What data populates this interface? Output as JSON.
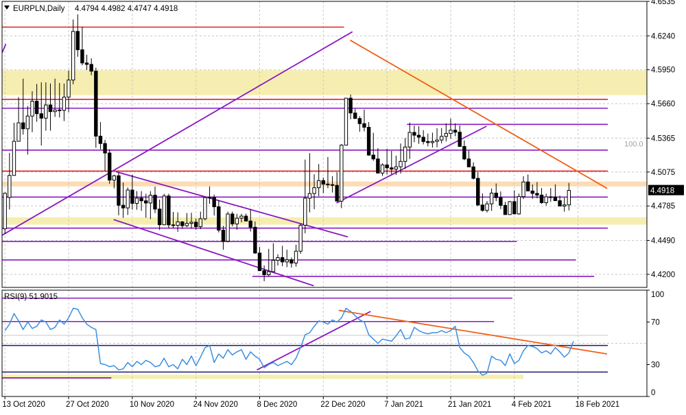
{
  "colors": {
    "grid": "#c8c8c8",
    "frame": "#000000",
    "bull": "#ffffff",
    "bear": "#000000",
    "zone": "#f5eeb0",
    "zone_orange": "#fcdcb4",
    "red_line": "#e02020",
    "purple_line": "#8a18c0",
    "orange_line": "#f06018",
    "rsi_line": "#3a8ee0",
    "price_marker_bg": "#000000",
    "price_marker_text": "#ffffff",
    "fib_label": "#a0a0a0"
  },
  "chart_data": [
    {
      "type": "candlestick",
      "title": "EURPLN,Daily",
      "ohlc_label": "4.4794 4.4982 4.4747 4.4918",
      "current_price": 4.4918,
      "current_price_label": "4.4918",
      "ylim": [
        4.4088,
        4.6535
      ],
      "y_ticks": [
        4.6535,
        4.624,
        4.595,
        4.566,
        4.5365,
        4.5075,
        4.4785,
        4.449,
        4.42
      ],
      "y_tick_labels": [
        "4.6535",
        "4.6240",
        "4.5950",
        "4.5660",
        "4.5365",
        "4.5075",
        "4.4785",
        "4.4490",
        "4.4200"
      ],
      "fib_label": "100.0",
      "fib_level": 4.5317,
      "x_labels": [
        "13 Oct 2020",
        "27 Oct 2020",
        "10 Nov 2020",
        "24 Nov 2020",
        "8 Dec 2020",
        "22 Dec 2020",
        "7 Jan 2021",
        "21 Jan 2021",
        "4 Feb 2021",
        "18 Feb 2021"
      ],
      "x_label_bars": [
        0,
        14,
        28,
        42,
        56,
        70,
        84,
        98,
        112,
        126
      ],
      "bar_count": 133,
      "candles": [
        [
          4.4589,
          4.49,
          4.4546,
          4.4894
        ],
        [
          4.4858,
          4.5239,
          4.4755,
          4.5046
        ],
        [
          4.5046,
          4.5496,
          4.5046,
          4.5338
        ],
        [
          4.5338,
          4.5716,
          4.534,
          4.5496
        ],
        [
          4.5496,
          4.5874,
          4.5396,
          4.5445
        ],
        [
          4.5445,
          4.564,
          4.5224,
          4.5554
        ],
        [
          4.5554,
          4.5766,
          4.5416,
          4.5681
        ],
        [
          4.5681,
          4.5829,
          4.5505,
          4.5574
        ],
        [
          4.5574,
          4.5842,
          4.5302,
          4.5536
        ],
        [
          4.5536,
          4.5842,
          4.5429,
          4.5649
        ],
        [
          4.5649,
          4.5832,
          4.5429,
          4.5592
        ],
        [
          4.5592,
          4.5874,
          4.5547,
          4.5606
        ],
        [
          4.5606,
          4.5837,
          4.5542,
          4.5603
        ],
        [
          4.5603,
          4.5832,
          4.5511,
          4.5716
        ],
        [
          4.5716,
          4.5943,
          4.5587,
          4.5862
        ],
        [
          4.5862,
          4.638,
          4.5826,
          4.6278
        ],
        [
          4.6278,
          4.6424,
          4.6061,
          4.6121
        ],
        [
          4.6121,
          4.6316,
          4.5988,
          4.6008
        ],
        [
          4.6008,
          4.6079,
          4.5948,
          4.5996
        ],
        [
          4.5996,
          4.6048,
          4.5903,
          4.5938
        ],
        [
          4.5938,
          4.5967,
          4.5283,
          4.5382
        ],
        [
          4.5382,
          4.5502,
          4.527,
          4.5319
        ],
        [
          4.5319,
          4.535,
          4.5083,
          4.5238
        ],
        [
          4.5238,
          4.527,
          4.4975,
          4.5006
        ],
        [
          4.5006,
          4.5052,
          4.4936,
          4.5043
        ],
        [
          4.5043,
          4.507,
          4.4705,
          4.4791
        ],
        [
          4.4791,
          4.4985,
          4.4684,
          4.4768
        ],
        [
          4.4768,
          4.4943,
          4.4708,
          4.4921
        ],
        [
          4.4921,
          4.5052,
          4.4753,
          4.4807
        ],
        [
          4.4807,
          4.4912,
          4.4753,
          4.4852
        ],
        [
          4.4852,
          4.4912,
          4.4743,
          4.4829
        ],
        [
          4.4829,
          4.4889,
          4.4684,
          4.481
        ],
        [
          4.481,
          4.4912,
          4.4673,
          4.4877
        ],
        [
          4.4877,
          4.495,
          4.4724,
          4.4758
        ],
        [
          4.4758,
          4.4839,
          4.4579,
          4.4624
        ],
        [
          4.4624,
          4.4889,
          4.462,
          4.487
        ],
        [
          4.487,
          4.4889,
          4.4594,
          4.4623
        ],
        [
          4.4623,
          4.4734,
          4.4594,
          4.4619
        ],
        [
          4.4619,
          4.473,
          4.4564,
          4.4649
        ],
        [
          4.4649,
          4.4655,
          4.459,
          4.4616
        ],
        [
          4.4616,
          4.4724,
          4.4604,
          4.4636
        ],
        [
          4.4636,
          4.4727,
          4.4591,
          4.4646
        ],
        [
          4.4646,
          4.4677,
          4.4581,
          4.4608
        ],
        [
          4.4608,
          4.4736,
          4.4586,
          4.4675
        ],
        [
          4.4675,
          4.4867,
          4.4662,
          4.4857
        ],
        [
          4.4857,
          4.4952,
          4.4803,
          4.4859
        ],
        [
          4.4859,
          4.4882,
          4.4703,
          4.4778
        ],
        [
          4.4778,
          4.4834,
          4.4558,
          4.4578
        ],
        [
          4.4578,
          4.4615,
          4.4411,
          4.4483
        ],
        [
          4.4483,
          4.4736,
          4.4474,
          4.4716
        ],
        [
          4.4716,
          4.4736,
          4.461,
          4.4631
        ],
        [
          4.4631,
          4.4717,
          4.4581,
          4.468
        ],
        [
          4.468,
          4.4718,
          4.4645,
          4.4698
        ],
        [
          4.4698,
          4.4719,
          4.4662,
          4.4656
        ],
        [
          4.4656,
          4.4757,
          4.4566,
          4.4603
        ],
        [
          4.4603,
          4.4652,
          4.4376,
          4.4382
        ],
        [
          4.4382,
          4.4434,
          4.428,
          4.4231
        ],
        [
          4.4231,
          4.4276,
          4.4141,
          4.4197
        ],
        [
          4.4197,
          4.4418,
          4.4184,
          4.4223
        ],
        [
          4.4223,
          4.4466,
          4.4218,
          4.432
        ],
        [
          4.432,
          4.4372,
          4.4275,
          4.4343
        ],
        [
          4.4343,
          4.4444,
          4.4269,
          4.4306
        ],
        [
          4.4306,
          4.4411,
          4.4261,
          4.4324
        ],
        [
          4.4324,
          4.4344,
          4.4258,
          4.4296
        ],
        [
          4.4296,
          4.4453,
          4.4266,
          4.4398
        ],
        [
          4.4398,
          4.4632,
          4.4376,
          4.462
        ],
        [
          4.462,
          4.5182,
          4.4551,
          4.4851
        ],
        [
          4.4851,
          4.5236,
          4.473,
          4.4891
        ],
        [
          4.4891,
          4.5056,
          4.4757,
          4.4941
        ],
        [
          4.4941,
          4.5143,
          4.4868,
          4.5002
        ],
        [
          4.5002,
          4.5028,
          4.4893,
          4.4972
        ],
        [
          4.4972,
          4.5203,
          4.4937,
          4.4967
        ],
        [
          4.4967,
          4.504,
          4.49,
          4.4961
        ],
        [
          4.4961,
          4.5073,
          4.4862,
          4.4826
        ],
        [
          4.4826,
          4.5314,
          4.4766,
          4.5305
        ],
        [
          4.5305,
          4.5708,
          4.5305,
          4.5707
        ],
        [
          4.5707,
          4.5738,
          4.5526,
          4.558
        ],
        [
          4.558,
          4.5615,
          4.5531,
          4.5533
        ],
        [
          4.5533,
          4.5553,
          4.542,
          4.5489
        ],
        [
          4.5489,
          4.561,
          4.5423,
          4.5458
        ],
        [
          4.5458,
          4.5503,
          4.5214,
          4.522
        ],
        [
          4.522,
          4.5411,
          4.5171,
          4.5187
        ],
        [
          4.5187,
          4.5279,
          4.508,
          4.5066
        ],
        [
          4.5066,
          4.5149,
          4.5041,
          4.5136
        ],
        [
          4.5136,
          4.5275,
          4.5055,
          4.5111
        ],
        [
          4.5111,
          4.5256,
          4.5055,
          4.51
        ],
        [
          4.51,
          4.5215,
          4.5051,
          4.512
        ],
        [
          4.512,
          4.5319,
          4.5062,
          4.5166
        ],
        [
          4.5166,
          4.5366,
          4.5101,
          4.5289
        ],
        [
          4.5289,
          4.5498,
          4.5186,
          4.5414
        ],
        [
          4.5414,
          4.5472,
          4.533,
          4.539
        ],
        [
          4.539,
          4.5468,
          4.5317,
          4.5373
        ],
        [
          4.5373,
          4.5434,
          4.5311,
          4.5336
        ],
        [
          4.5336,
          4.5404,
          4.5294,
          4.5327
        ],
        [
          4.5327,
          4.5412,
          4.5285,
          4.5337
        ],
        [
          4.5337,
          4.545,
          4.5287,
          4.5349
        ],
        [
          4.5349,
          4.5452,
          4.532,
          4.538
        ],
        [
          4.538,
          4.5491,
          4.5337,
          4.5405
        ],
        [
          4.5405,
          4.5533,
          4.536,
          4.5433
        ],
        [
          4.5433,
          4.5491,
          4.5382,
          4.5416
        ],
        [
          4.5416,
          4.5474,
          4.529,
          4.5294
        ],
        [
          4.5294,
          4.5345,
          4.5176,
          4.5187
        ],
        [
          4.5187,
          4.5258,
          4.512,
          4.5119
        ],
        [
          4.5119,
          4.5158,
          4.5012,
          4.5021
        ],
        [
          4.5021,
          4.5075,
          4.4783,
          4.4793
        ],
        [
          4.4793,
          4.4892,
          4.4736,
          4.4747
        ],
        [
          4.4747,
          4.4827,
          4.4729,
          4.4803
        ],
        [
          4.4803,
          4.4935,
          4.4743,
          4.4895
        ],
        [
          4.4895,
          4.4977,
          4.4826,
          4.4856
        ],
        [
          4.4856,
          4.4909,
          4.4758,
          4.479
        ],
        [
          4.479,
          4.482,
          4.4713,
          4.4711
        ],
        [
          4.4711,
          4.4827,
          4.4708,
          4.4822
        ],
        [
          4.4822,
          4.4919,
          4.4713,
          4.4717
        ],
        [
          4.4717,
          4.489,
          4.471,
          4.4865
        ],
        [
          4.4865,
          4.5039,
          4.4844,
          4.499
        ],
        [
          4.499,
          4.5054,
          4.492,
          4.4913
        ],
        [
          4.4913,
          4.4969,
          4.4846,
          4.4892
        ],
        [
          4.4892,
          4.4989,
          4.485,
          4.4878
        ],
        [
          4.4878,
          4.4938,
          4.4803,
          4.4813
        ],
        [
          4.4813,
          4.489,
          4.4788,
          4.4863
        ],
        [
          4.4863,
          4.4938,
          4.482,
          4.4862
        ],
        [
          4.4862,
          4.4969,
          4.4827,
          4.483
        ],
        [
          4.483,
          4.4873,
          4.4796,
          4.4784
        ],
        [
          4.4784,
          4.4855,
          4.4736,
          4.4794
        ],
        [
          4.4794,
          4.4982,
          4.4747,
          4.4918
        ]
      ],
      "zones": [
        {
          "from": 4.5733,
          "to": 4.5945,
          "color": "zone"
        },
        {
          "from": 4.4952,
          "to": 4.4994,
          "color": "zone_orange"
        },
        {
          "from": 4.4625,
          "to": 4.4688,
          "color": "zone"
        }
      ],
      "hlines": [
        {
          "y": 4.6315,
          "x_from": 0,
          "x_to": 75,
          "color": "red_line"
        },
        {
          "y": 4.5697,
          "x_from": 0,
          "x_to": 133,
          "color": "red_line"
        },
        {
          "y": 4.5083,
          "x_from": 0,
          "x_to": 133,
          "color": "red_line"
        },
        {
          "y": 4.5621,
          "x_from": 0,
          "x_to": 133,
          "color": "purple_line"
        },
        {
          "y": 4.5483,
          "x_from": 89,
          "x_to": 133,
          "color": "purple_line"
        },
        {
          "y": 4.5263,
          "x_from": 0,
          "x_to": 133,
          "color": "purple_line"
        },
        {
          "y": 4.4861,
          "x_from": 0,
          "x_to": 133,
          "color": "purple_line"
        },
        {
          "y": 4.4595,
          "x_from": 0,
          "x_to": 133,
          "color": "purple_line"
        },
        {
          "y": 4.4481,
          "x_from": 0,
          "x_to": 113,
          "color": "purple_line"
        },
        {
          "y": 4.4323,
          "x_from": 0,
          "x_to": 126,
          "color": "purple_line"
        },
        {
          "y": 4.4182,
          "x_from": 55,
          "x_to": 130,
          "color": "purple_line"
        }
      ],
      "trendlines": [
        {
          "x1": 0,
          "y1": 4.4535,
          "x2": 77,
          "y2": 4.6275,
          "color": "purple_line"
        },
        {
          "x1": 0,
          "y1": 4.6098,
          "x2": 0.8,
          "y2": 4.617,
          "color": "purple_line"
        },
        {
          "x1": 25,
          "y1": 4.5078,
          "x2": 76,
          "y2": 4.452,
          "color": "purple_line"
        },
        {
          "x1": 24.5,
          "y1": 4.4668,
          "x2": 68.5,
          "y2": 4.4102,
          "color": "purple_line"
        },
        {
          "x1": 73.5,
          "y1": 4.481,
          "x2": 106.5,
          "y2": 4.5467,
          "color": "purple_line"
        },
        {
          "x1": 76.5,
          "y1": 4.6203,
          "x2": 133,
          "y2": 4.4935,
          "color": "orange_line"
        }
      ]
    },
    {
      "type": "line",
      "title": "RSI(9) 51.9015",
      "ylim": [
        0,
        100
      ],
      "y_ticks": [
        100,
        70,
        30,
        0
      ],
      "y_tick_labels": [
        "100",
        "70",
        "30",
        "0"
      ],
      "series": [
        {
          "color": "rsi_line",
          "values": [
            62,
            68,
            78,
            71,
            63,
            70,
            64,
            66,
            72,
            70,
            63,
            65,
            72,
            68,
            74,
            83,
            82,
            74,
            68,
            65,
            63,
            31,
            30,
            28,
            29,
            25,
            26,
            32,
            28,
            33,
            30,
            34,
            32,
            28,
            29,
            36,
            28,
            30,
            26,
            35,
            30,
            38,
            29,
            37,
            46,
            48,
            32,
            40,
            36,
            44,
            39,
            42,
            44,
            35,
            42,
            38,
            35,
            27,
            30,
            32,
            29,
            31,
            33,
            30,
            36,
            46,
            58,
            60,
            66,
            71,
            70,
            68,
            72,
            70,
            74,
            83,
            80,
            76,
            72,
            70,
            58,
            54,
            50,
            54,
            53,
            52,
            57,
            63,
            54,
            55,
            65,
            62,
            60,
            59,
            60,
            60,
            62,
            60,
            62,
            66,
            46,
            41,
            38,
            32,
            24,
            20,
            22,
            38,
            35,
            34,
            29,
            40,
            31,
            34,
            43,
            48,
            47,
            45,
            41,
            43,
            40,
            46,
            42,
            37,
            41,
            52
          ]
        }
      ],
      "levels": [
        {
          "y": 92.5,
          "x_from": 0,
          "x_to": 112,
          "color": "purple_line"
        },
        {
          "y": 70.5,
          "x_from": 0,
          "x_to": 108,
          "color": "purple_line"
        },
        {
          "y": 57.5,
          "x_from": 0,
          "x_to": 133,
          "color": "grid"
        },
        {
          "y": 48.0,
          "x_from": 0,
          "x_to": 133,
          "color": "navy"
        },
        {
          "y": 23.0,
          "x_from": 0,
          "x_to": 133,
          "color": "navy"
        }
      ],
      "zones": [
        {
          "from": 16.5,
          "to": 20.5,
          "x_from": 0,
          "x_to": 114,
          "color": "zone"
        }
      ],
      "trendlines": [
        {
          "x1": 56,
          "y1": 25,
          "x2": 81,
          "y2": 80,
          "color": "purple_line"
        },
        {
          "x1": 74,
          "y1": 81,
          "x2": 133,
          "y2": 40,
          "color": "orange_line"
        },
        {
          "x1": 0,
          "y1": 17.5,
          "x2": 24,
          "y2": 17.5,
          "color": "purple_line"
        }
      ]
    }
  ]
}
